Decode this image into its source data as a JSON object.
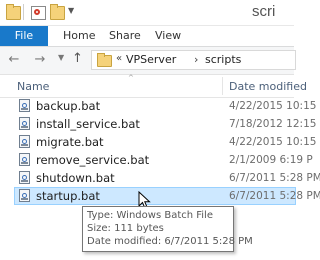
{
  "window": {
    "title": "scri"
  },
  "ribbon": {
    "tabs": [
      "File",
      "Home",
      "Share",
      "View"
    ]
  },
  "address": {
    "prefix": "«",
    "crumbs": [
      "VPServer",
      "scripts"
    ],
    "separator": "›"
  },
  "columns": {
    "name": "Name",
    "date_modified": "Date modified"
  },
  "files": [
    {
      "name": "backup.bat",
      "date": "4/22/2015 10:15",
      "selected": false
    },
    {
      "name": "install_service.bat",
      "date": "7/18/2012 12:15",
      "selected": false
    },
    {
      "name": "migrate.bat",
      "date": "4/22/2015 10:15",
      "selected": false
    },
    {
      "name": "remove_service.bat",
      "date": "2/1/2009 6:19 P",
      "selected": false
    },
    {
      "name": "shutdown.bat",
      "date": "6/7/2011 5:28 PM",
      "selected": false
    },
    {
      "name": "startup.bat",
      "date": "6/7/2011 5:28 PM",
      "selected": true
    }
  ],
  "tooltip": {
    "type": "Type: Windows Batch File",
    "size": "Size: 111 bytes",
    "modified": "Date modified: 6/7/2011 5:28 PM"
  },
  "icons": {
    "qa_folder": "folder-icon",
    "qa_properties": "properties-icon",
    "file_icon": "batch-file-icon",
    "cursor": "mouse-pointer-icon"
  }
}
